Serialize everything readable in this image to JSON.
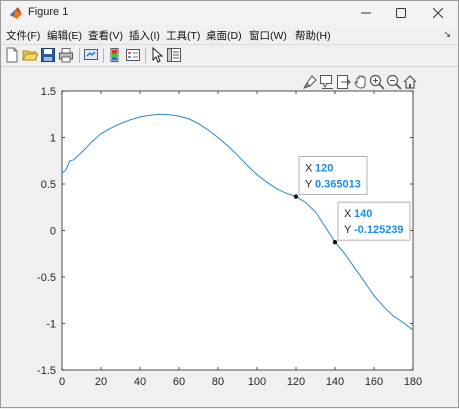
{
  "window": {
    "title": "Figure 1",
    "minimize_icon": "minimize-icon",
    "maximize_icon": "maximize-icon",
    "close_icon": "close-icon"
  },
  "menu": {
    "items": [
      {
        "label": "文件(F)"
      },
      {
        "label": "编辑(E)"
      },
      {
        "label": "查看(V)"
      },
      {
        "label": "插入(I)"
      },
      {
        "label": "工具(T)"
      },
      {
        "label": "桌面(D)"
      },
      {
        "label": "窗口(W)"
      },
      {
        "label": "帮助(H)"
      }
    ]
  },
  "toolbar": {
    "icons": [
      "new-figure-icon",
      "open-file-icon",
      "save-icon",
      "print-icon",
      "link-plot-icon",
      "colorbar-icon",
      "legend-icon",
      "edit-plot-icon",
      "property-inspector-icon"
    ]
  },
  "axes_toolbar": {
    "icons": [
      "brush-icon",
      "data-tips-icon",
      "export-icon",
      "pan-icon",
      "zoom-in-icon",
      "zoom-out-icon",
      "home-icon"
    ]
  },
  "chart_data": {
    "type": "line",
    "title": "",
    "xlabel": "",
    "ylabel": "",
    "xlim": [
      0,
      180
    ],
    "ylim": [
      -1.5,
      1.5
    ],
    "xticks": [
      "0",
      "20",
      "40",
      "60",
      "80",
      "100",
      "120",
      "140",
      "160",
      "180"
    ],
    "yticks": [
      "1.5",
      "1",
      "0.5",
      "0",
      "-0.5",
      "-1",
      "-1.5"
    ],
    "grid": false,
    "line_color": "#2e86c1",
    "series": [
      {
        "x": [
          0,
          2,
          4,
          6,
          8,
          10,
          12,
          15,
          20,
          25,
          30,
          35,
          40,
          45,
          50,
          55,
          60,
          65,
          70,
          75,
          80,
          85,
          90,
          95,
          100,
          105,
          110,
          115,
          120,
          125,
          130,
          135,
          140,
          145,
          150,
          155,
          160,
          165,
          170,
          175,
          180
        ],
        "y": [
          0.62,
          0.65,
          0.75,
          0.76,
          0.8,
          0.84,
          0.88,
          0.95,
          1.04,
          1.1,
          1.15,
          1.19,
          1.22,
          1.24,
          1.25,
          1.245,
          1.23,
          1.2,
          1.15,
          1.08,
          1.0,
          0.91,
          0.81,
          0.7,
          0.6,
          0.52,
          0.45,
          0.4,
          0.365013,
          0.3,
          0.2,
          0.04,
          -0.125239,
          -0.25,
          -0.4,
          -0.55,
          -0.7,
          -0.82,
          -0.92,
          -0.99,
          -1.07
        ]
      }
    ],
    "datatips": [
      {
        "x_label": "X",
        "x_value": "120",
        "y_label": "Y",
        "y_value": "0.365013",
        "x": 120,
        "y": 0.365013
      },
      {
        "x_label": "X",
        "x_value": "140",
        "y_label": "Y",
        "y_value": "-0.125239",
        "x": 140,
        "y": -0.125239
      }
    ]
  }
}
